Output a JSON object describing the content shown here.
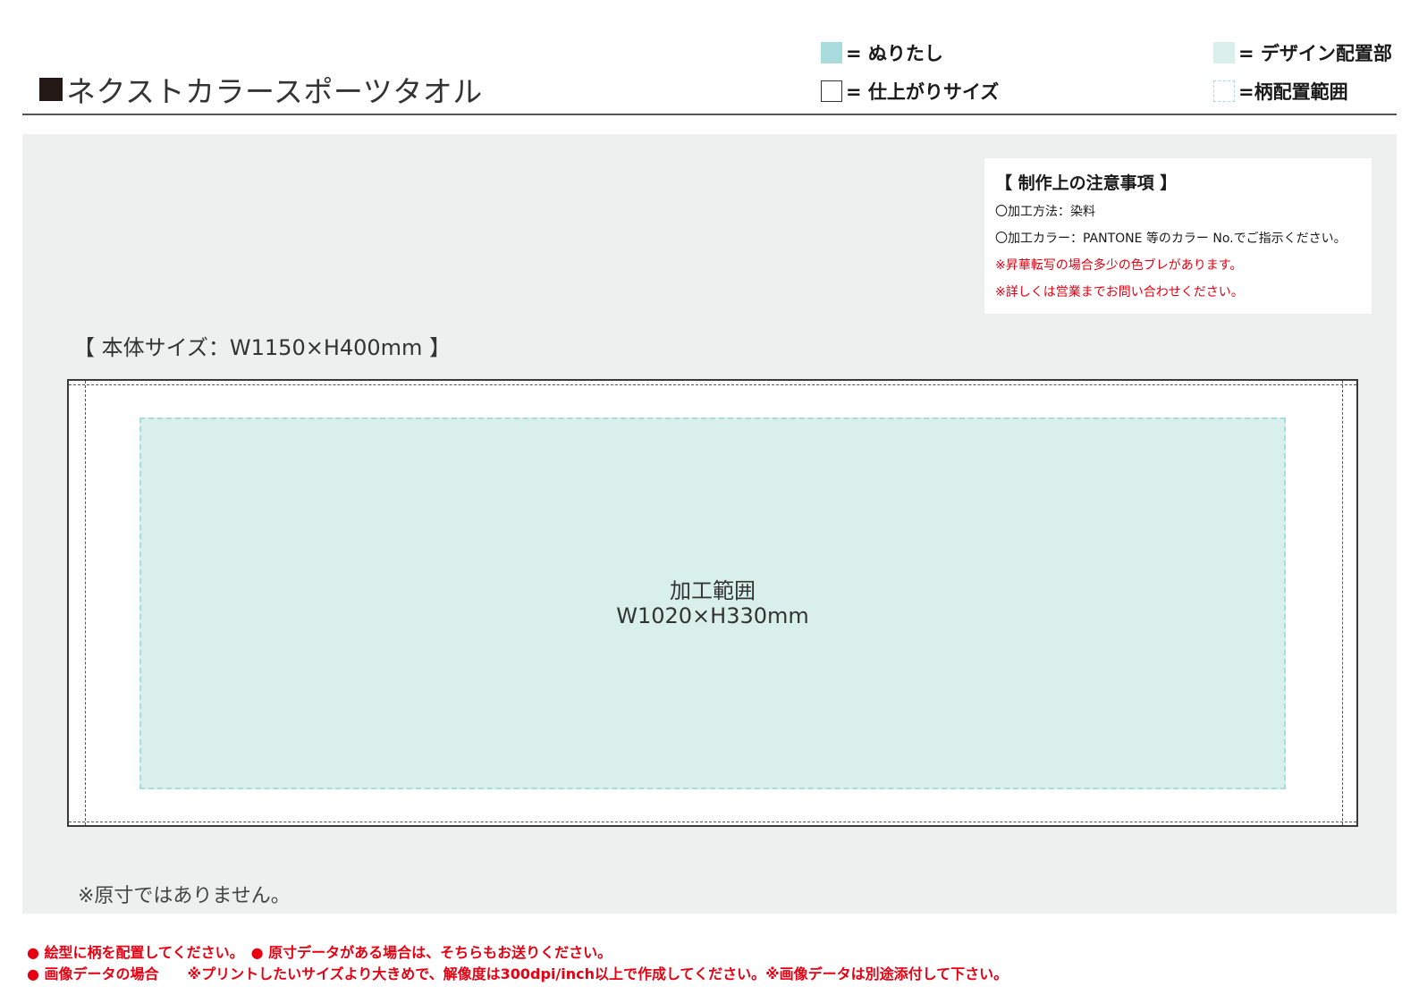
{
  "header": {
    "title": "ネクストカラースポーツタオル",
    "legend": {
      "bleed": "= ぬりたし",
      "finish_size": "= 仕上がりサイズ",
      "design_area": "= デザイン配置部",
      "pattern_range": "=柄配置範囲"
    }
  },
  "colors": {
    "bleed": "#a9dcdc",
    "design": "#d9efec",
    "panel": "#eeefef",
    "warning": "#e60012"
  },
  "notes": {
    "title": "【 制作上の注意事項 】",
    "lines": [
      "〇加工方法：染料",
      "〇加工カラー：PANTONE 等のカラー No.でご指示ください。",
      "※昇華転写の場合多少の色ブレがあります。",
      "※詳しくは営業までお問い合わせください。"
    ]
  },
  "body_size_label": "【 本体サイズ：W1150×H400mm 】",
  "design_area": {
    "label": "加工範囲",
    "size": "W1020×H330mm"
  },
  "footnote": "※原寸ではありません。",
  "bottom_notes": [
    "● 絵型に柄を配置してください。　● 原寸データがある場合は、そちらもお送りください。",
    "● 画像データの場合　　※プリントしたいサイズより大きめで、解像度は300dpi/inch以上で作成してください。※画像データは別途添付して下さい。"
  ]
}
